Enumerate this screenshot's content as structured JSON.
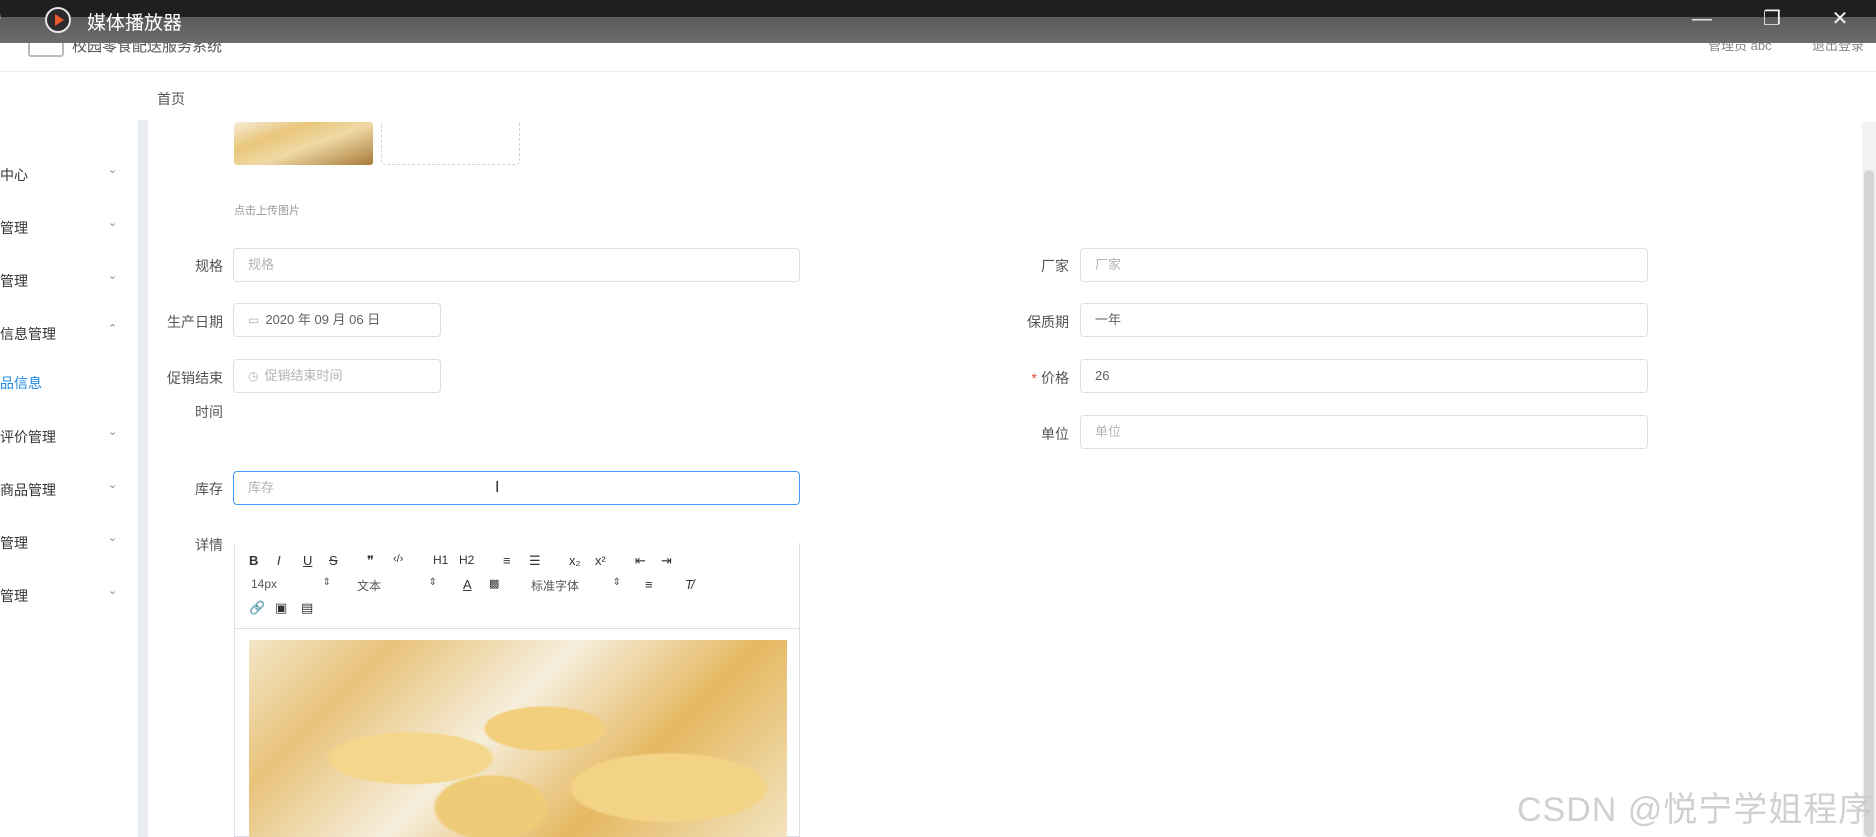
{
  "titlebar": {
    "title": "媒体播放器",
    "left_glyph": ")",
    "minimize": "—",
    "restore": "❐",
    "close": "✕"
  },
  "header": {
    "system_name": "校园零食配送服务系统",
    "admin": "管理员 abc",
    "logout": "退出登录"
  },
  "breadcrumb": {
    "home": "首页"
  },
  "sidebar": {
    "items": [
      {
        "label": "中心",
        "chevron": "⌄"
      },
      {
        "label": "管理",
        "chevron": "⌄"
      },
      {
        "label": "管理",
        "chevron": "⌄"
      },
      {
        "label": "信息管理",
        "chevron": "⌃"
      },
      {
        "label": "品信息",
        "chevron": ""
      },
      {
        "label": "评价管理",
        "chevron": "⌄"
      },
      {
        "label": "商品管理",
        "chevron": "⌄"
      },
      {
        "label": "管理",
        "chevron": "⌄"
      },
      {
        "label": "管理",
        "chevron": "⌄"
      }
    ]
  },
  "form": {
    "upload_tip": "点击上传图片",
    "spec": {
      "label": "规格",
      "placeholder": "规格"
    },
    "manufacturer": {
      "label": "厂家",
      "placeholder": "厂家"
    },
    "production_date": {
      "label": "生产日期",
      "value": "2020 年 09 月 06 日"
    },
    "shelf_life": {
      "label": "保质期",
      "value": "一年"
    },
    "promo_end": {
      "label_line1": "促销结束",
      "label_line2": "时间",
      "placeholder": "促销结束时间"
    },
    "price": {
      "label": "价格",
      "required_mark": "*",
      "value": "26"
    },
    "unit": {
      "label": "单位",
      "placeholder": "单位"
    },
    "stock": {
      "label": "库存",
      "placeholder": "库存"
    },
    "detail": {
      "label": "详情"
    }
  },
  "editor": {
    "font_size": "14px",
    "block_type": "文本",
    "font_family": "标准字体",
    "buttons": [
      "B",
      "I",
      "U",
      "S",
      "❞",
      "‹/›",
      "H1",
      "H2",
      "≡",
      "☰",
      "x₂",
      "x²",
      "⇤",
      "⇥"
    ]
  },
  "icons": {
    "calendar": "calendar-icon",
    "clock": "clock-icon",
    "text_cursor": "I"
  },
  "watermark": "CSDN @悦宁学姐程序",
  "colors": {
    "accent": "#409eff",
    "active_nav": "#1e88e5",
    "required": "#e74c3c"
  }
}
